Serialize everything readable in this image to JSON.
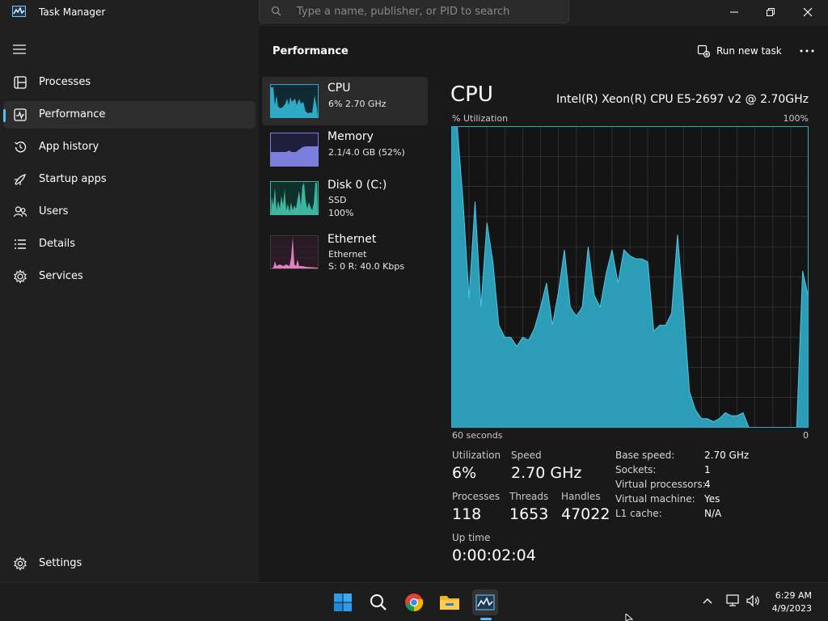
{
  "window": {
    "title": "Task Manager",
    "search_placeholder": "Type a name, publisher, or PID to search"
  },
  "sidebar": {
    "items": [
      {
        "label": "Processes",
        "icon": "processes-icon"
      },
      {
        "label": "Performance",
        "icon": "performance-icon",
        "active": true
      },
      {
        "label": "App history",
        "icon": "history-icon"
      },
      {
        "label": "Startup apps",
        "icon": "startup-icon"
      },
      {
        "label": "Users",
        "icon": "users-icon"
      },
      {
        "label": "Details",
        "icon": "details-icon"
      },
      {
        "label": "Services",
        "icon": "services-icon"
      }
    ],
    "settings_label": "Settings"
  },
  "main": {
    "title": "Performance",
    "run_new_task": "Run new task"
  },
  "resources": [
    {
      "name": "CPU",
      "sub1": "6%  2.70 GHz",
      "sub2": "",
      "color": "#2ea9c6"
    },
    {
      "name": "Memory",
      "sub1": "2.1/4.0 GB (52%)",
      "sub2": "",
      "color": "#7b7fdc"
    },
    {
      "name": "Disk 0 (C:)",
      "sub1": "SSD",
      "sub2": "100%",
      "color": "#3fb4a0"
    },
    {
      "name": "Ethernet",
      "sub1": "Ethernet",
      "sub2": "S: 0 R: 40.0 Kbps",
      "color": "#e27fc0"
    }
  ],
  "detail": {
    "title": "CPU",
    "model": "Intel(R) Xeon(R) CPU E5-2697 v2 @ 2.70GHz",
    "util_label": "% Utilization",
    "util_max": "100%",
    "time_label": "60 seconds",
    "time_zero": "0",
    "stats": {
      "utilization_label": "Utilization",
      "utilization": "6%",
      "speed_label": "Speed",
      "speed": "2.70 GHz",
      "processes_label": "Processes",
      "processes": "118",
      "threads_label": "Threads",
      "threads": "1653",
      "handles_label": "Handles",
      "handles": "47022",
      "uptime_label": "Up time",
      "uptime": "0:00:02:04"
    },
    "specs": [
      {
        "label": "Base speed:",
        "value": "2.70 GHz"
      },
      {
        "label": "Sockets:",
        "value": "1"
      },
      {
        "label": "Virtual processors:",
        "value": "4"
      },
      {
        "label": "Virtual machine:",
        "value": "Yes"
      },
      {
        "label": "L1 cache:",
        "value": "N/A"
      }
    ]
  },
  "chart_data": {
    "type": "area",
    "ylim": [
      0,
      100
    ],
    "xlim": [
      60,
      0
    ],
    "x": [
      60,
      59,
      58,
      57,
      56,
      55,
      54,
      53,
      52,
      51,
      50,
      49,
      48,
      47,
      46,
      45,
      44,
      43,
      42,
      41,
      40,
      39,
      38,
      37,
      36,
      35,
      34,
      33,
      32,
      31,
      30,
      29,
      28,
      27,
      26,
      25,
      24,
      23,
      22,
      21,
      20,
      19,
      18,
      17,
      16,
      15,
      14,
      13,
      12,
      11,
      10,
      9,
      8,
      7,
      6,
      5,
      4,
      3,
      2,
      1,
      0
    ],
    "values": [
      100,
      100,
      75,
      43,
      75,
      40,
      68,
      55,
      34,
      30,
      30,
      27,
      30,
      29,
      33,
      40,
      48,
      34,
      45,
      59,
      40,
      37,
      40,
      60,
      44,
      40,
      51,
      59,
      48,
      59,
      57,
      56,
      56,
      55,
      32,
      34,
      34,
      38,
      64,
      40,
      12,
      6,
      3,
      3,
      2,
      3,
      5,
      4,
      4,
      5,
      0,
      0,
      0,
      0,
      0,
      0,
      0,
      0,
      0,
      52,
      43,
      7
    ],
    "color": "#2ea9c6"
  },
  "taskbar": {
    "time": "6:29 AM",
    "date": "4/9/2023"
  }
}
